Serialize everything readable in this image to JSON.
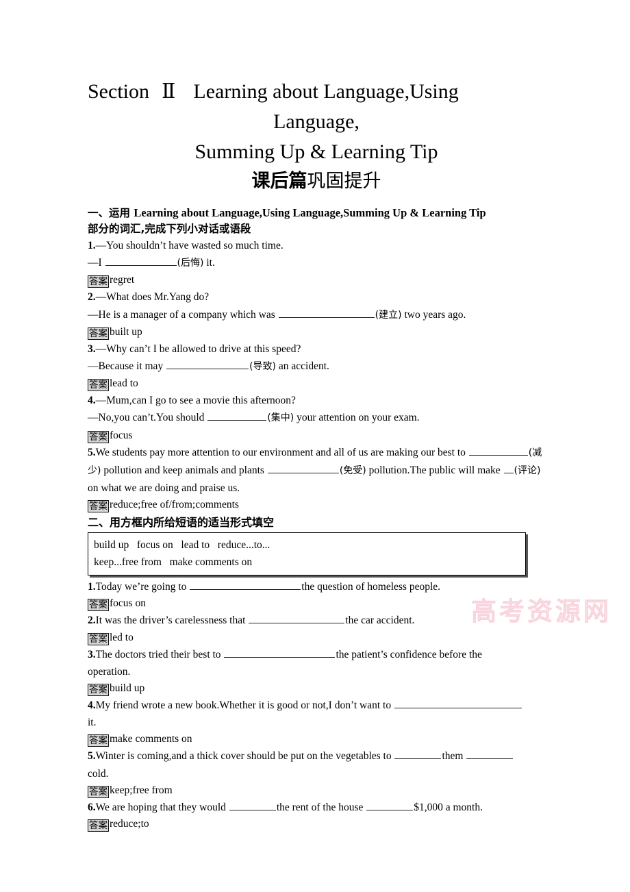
{
  "document": {
    "title_lines": [
      {
        "section_word": "Section",
        "numeral": "Ⅱ",
        "rest": "Learning about Language,Using"
      },
      {
        "text": "Language,"
      },
      {
        "text": "Summing Up & Learning Tip"
      }
    ],
    "subtitle_cn_bold": "课后篇",
    "subtitle_cn_rest": "巩固提升",
    "watermark": "高考资源网"
  },
  "section1": {
    "heading_prefix": "一、运用 ",
    "heading_en": "Learning about Language,Using Language,Summing Up & Learning Tip",
    "heading_suffix": "部分的词汇,完成下列小对话或语段",
    "answer_badge": "答案",
    "items": [
      {
        "num": "1.",
        "line1": "—You shouldn’t have wasted so much time.",
        "line2_pre": "—I ",
        "line2_cn": "(后悔)",
        "line2_post": " it.",
        "answer": "regret"
      },
      {
        "num": "2.",
        "line1": "—What does Mr.Yang do?",
        "line2_pre": "—He is a manager of a company which was ",
        "line2_cn": "(建立)",
        "line2_post": " two years ago.",
        "answer": "built up"
      },
      {
        "num": "3.",
        "line1": "—Why can’t I be allowed to drive at this speed?",
        "line2_pre": "—Because it may ",
        "line2_cn": "(导致)",
        "line2_post": " an accident.",
        "answer": "lead to"
      },
      {
        "num": "4.",
        "line1": "—Mum,can I go to see a movie this afternoon?",
        "line2_pre": "—No,you can’t.You should ",
        "line2_cn": "(集中)",
        "line2_post": " your attention on your exam.",
        "answer": "focus"
      },
      {
        "num": "5.",
        "p_a": "We students pay more attention to our environment and all of us are making our best to ",
        "p_b_cn": "(减少)",
        "p_b": " pollution and keep animals and plants ",
        "p_c_cn": "(免受)",
        "p_c": " pollution.The public will make ",
        "p_d_cn": "(评论)",
        "p_d": " on what we are doing and praise us.",
        "answer": "reduce;free of/from;comments"
      }
    ]
  },
  "section2": {
    "heading": "二、用方框内所给短语的适当形式填空",
    "answer_badge": "答案",
    "wordbank": [
      "build up   focus on   lead to   reduce...to...",
      "keep...free from   make comments on"
    ],
    "items": [
      {
        "num": "1.",
        "pre": "Today we’re going to ",
        "post": "the question of homeless people.",
        "answer": "focus on"
      },
      {
        "num": "2.",
        "pre": "It was the driver’s carelessness that ",
        "post": "the car accident.",
        "answer": "led to"
      },
      {
        "num": "3.",
        "pre": "The doctors tried their best to ",
        "post": "the patient’s confidence before the",
        "post2": "operation.",
        "answer": "build up"
      },
      {
        "num": "4.",
        "pre": "My friend wrote a new book.Whether it is good or not,I don’t want to ",
        "post": "",
        "post2": "it.",
        "answer": "make comments on"
      },
      {
        "num": "5.",
        "pre": "Winter is coming,and a thick cover should be put on the vegetables to ",
        "mid": "them ",
        "post2": "cold.",
        "answer": "keep;free from"
      },
      {
        "num": "6.",
        "pre": "We are hoping that they would ",
        "mid": "the rent of the house ",
        "post": "$1,000 a month.",
        "answer": "reduce;to"
      }
    ]
  }
}
